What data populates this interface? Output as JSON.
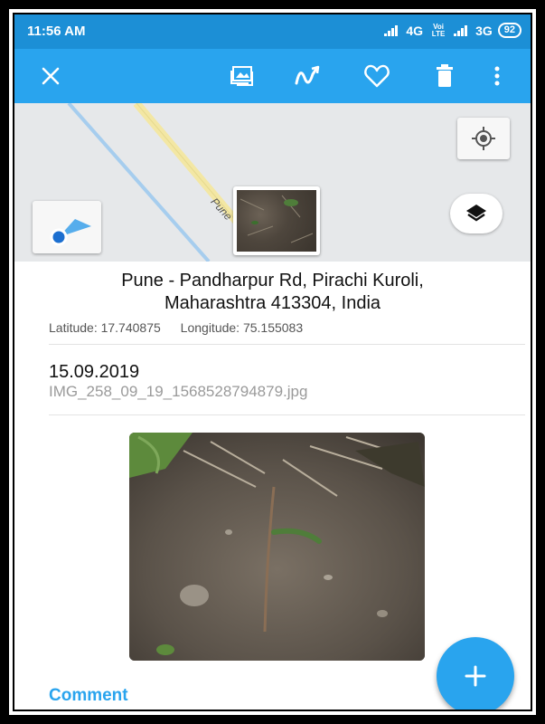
{
  "status_bar": {
    "time": "11:56 AM",
    "network_1": "4G",
    "network_sub": "Voi LTE",
    "network_2": "3G",
    "battery": "92"
  },
  "toolbar": {
    "icons": [
      "close-icon",
      "gallery-icon",
      "route-icon",
      "favorite-icon",
      "delete-icon",
      "more-icon"
    ]
  },
  "map": {
    "road_label": "Pune"
  },
  "location": {
    "address_line1": "Pune - Pandharpur Rd, Pirachi Kuroli,",
    "address_line2": "Maharashtra 413304, India",
    "latitude": "Latitude: 17.740875",
    "longitude": "Longitude: 75.155083"
  },
  "photo_info": {
    "date": "15.09.2019",
    "filename": "IMG_258_09_19_1568528794879.jpg"
  },
  "comment_label": "Comment",
  "colors": {
    "status_bar": "#1c8fd6",
    "toolbar": "#29a4ee",
    "accent": "#29a4ee"
  }
}
